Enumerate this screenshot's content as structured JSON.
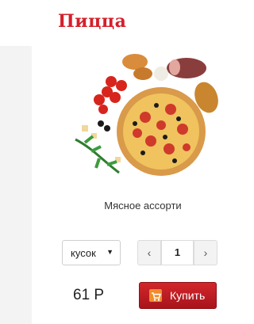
{
  "brand": {
    "title": "Пицца"
  },
  "product": {
    "name": "Мясное ассорти",
    "image_icon": "pizza-image"
  },
  "unit": {
    "selected": "кусок",
    "options": [
      "кусок"
    ]
  },
  "quantity": {
    "value": "1",
    "dec_symbol": "‹",
    "inc_symbol": "›"
  },
  "price": "61 Р",
  "buy": {
    "label": "Купить",
    "icon": "cart-icon"
  },
  "colors": {
    "brand_red": "#d3202b",
    "button_red": "#c11b22"
  }
}
